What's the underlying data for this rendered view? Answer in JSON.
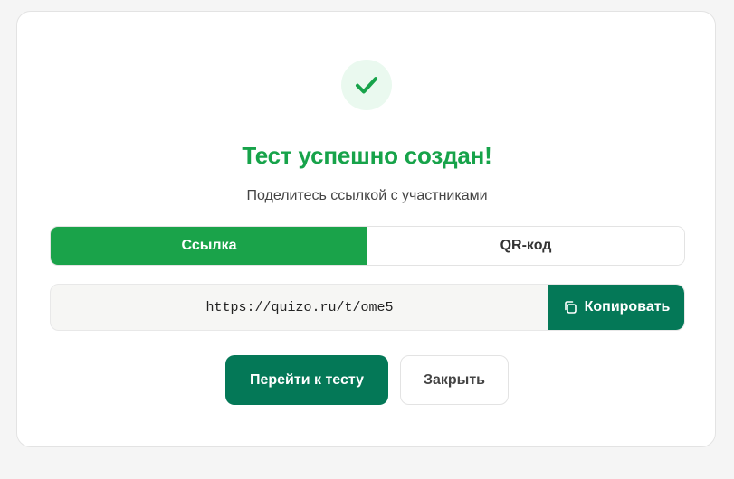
{
  "dialog": {
    "title": "Тест успешно создан!",
    "subtitle": "Поделитесь ссылкой с участниками",
    "icons": {
      "success": "check-icon",
      "copy": "copy-icon"
    },
    "colors": {
      "success_green": "#17a34a",
      "primary": "#047857",
      "success_bg": "#eaf9ef"
    }
  },
  "tabs": [
    {
      "label": "Ссылка",
      "active": true
    },
    {
      "label": "QR-код",
      "active": false
    }
  ],
  "share": {
    "url": "https://quizo.ru/t/ome5",
    "copy_label": "Копировать"
  },
  "actions": {
    "go_label": "Перейти к тесту",
    "close_label": "Закрыть"
  }
}
